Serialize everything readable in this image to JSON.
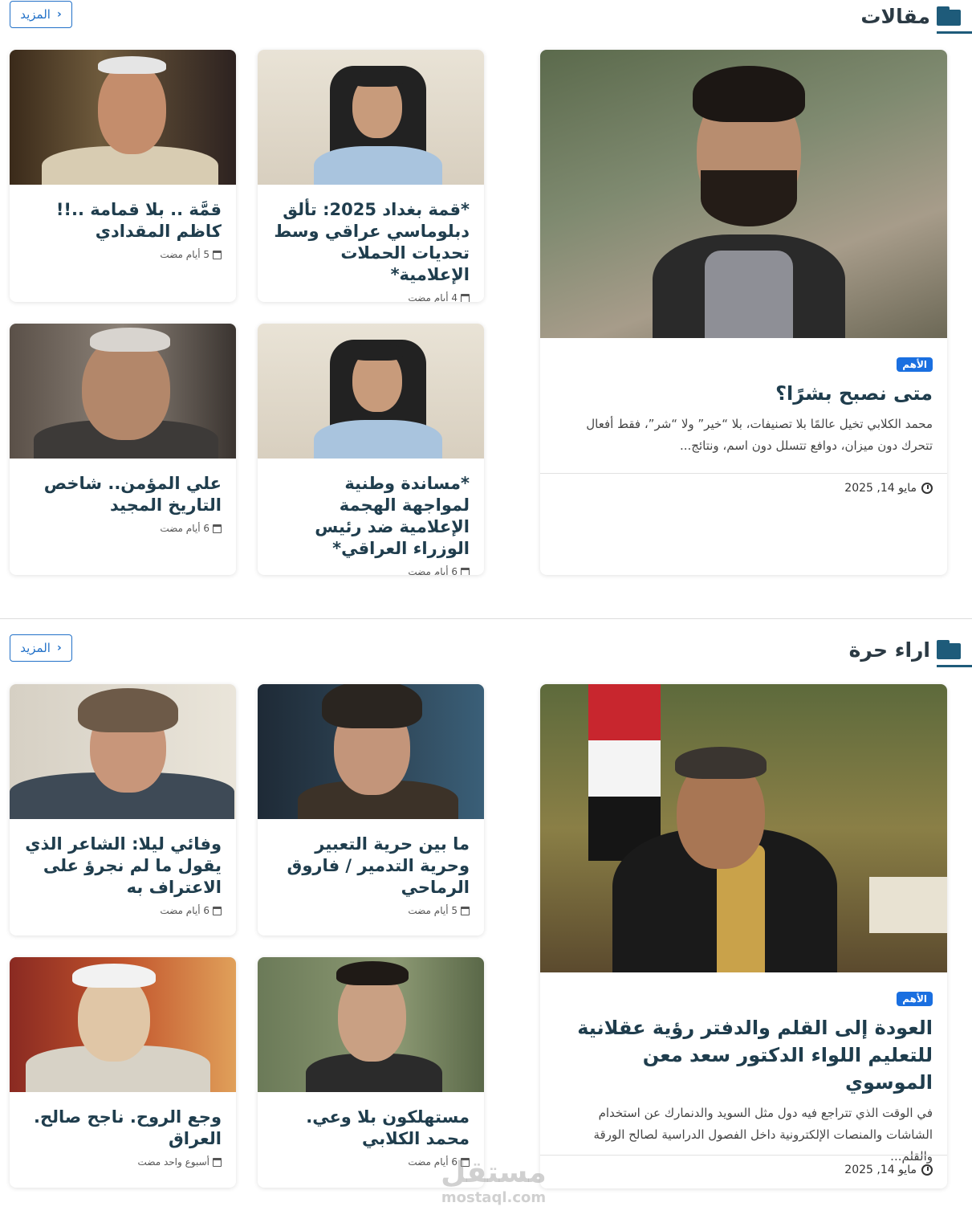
{
  "sections": [
    {
      "title": "مقالات",
      "more_label": "المزيد",
      "featured": {
        "badge": "الأهم",
        "title": "متى نصبح بشرًا؟",
        "excerpt": "محمد الكلابي تخيل عالمًا بلا تصنيفات، بلا “خير” ولا “شر”، فقط أفعال تتحرك دون ميزان، دوافع تتسلل دون اسم، ونتائج...",
        "date": "مايو 14, 2025"
      },
      "cards": [
        {
          "title": "*قمة بغداد 2025: تألق دبلوماسي عراقي وسط تحديات الحملات الإعلامية*",
          "time": "4 أيام مضت"
        },
        {
          "title": "قمَّة .. بلا قمامة ..!! كاظم المقدادي",
          "time": "5 أيام مضت"
        },
        {
          "title": "*مساندة وطنية لمواجهة الهجمة الإعلامية ضد رئيس الوزراء العراقي*",
          "time": "6 أيام مضت"
        },
        {
          "title": "علي المؤمن.. شاخص التاريخ المجيد",
          "time": "6 أيام مضت"
        }
      ]
    },
    {
      "title": "اراء حرة",
      "more_label": "المزيد",
      "featured": {
        "badge": "الأهم",
        "title": "العودة إلى القلم والدفتر رؤية عقلانية للتعليم اللواء الدكتور  سعد معن الموسوي",
        "excerpt": "في الوقت الذي تتراجع فيه دول مثل السويد والدنمارك عن استخدام الشاشات والمنصات الإلكترونية داخل الفصول الدراسية لصالح الورقة والقلم...",
        "date": "مايو 14, 2025"
      },
      "cards": [
        {
          "title": "ما بين حرية التعبير وحرية التدمير / فاروق الرماحي",
          "time": "5 أيام مضت"
        },
        {
          "title": "وفائي ليلا: الشاعر الذي يقول ما لم نجرؤ على الاعتراف به",
          "time": "6 أيام مضت"
        },
        {
          "title": "مستهلكون بلا وعي. محمد الكلابي",
          "time": "6 أيام مضت"
        },
        {
          "title": "وجع الروح. ناجح صالح. العراق",
          "time": "أسبوع واحد مضت"
        }
      ]
    }
  ],
  "watermark": {
    "arabic": "مستقل",
    "latin": "mostaql.com"
  },
  "colors": {
    "accent": "#1e5b7a",
    "link": "#2271c8",
    "badge": "#1a6fe0"
  }
}
